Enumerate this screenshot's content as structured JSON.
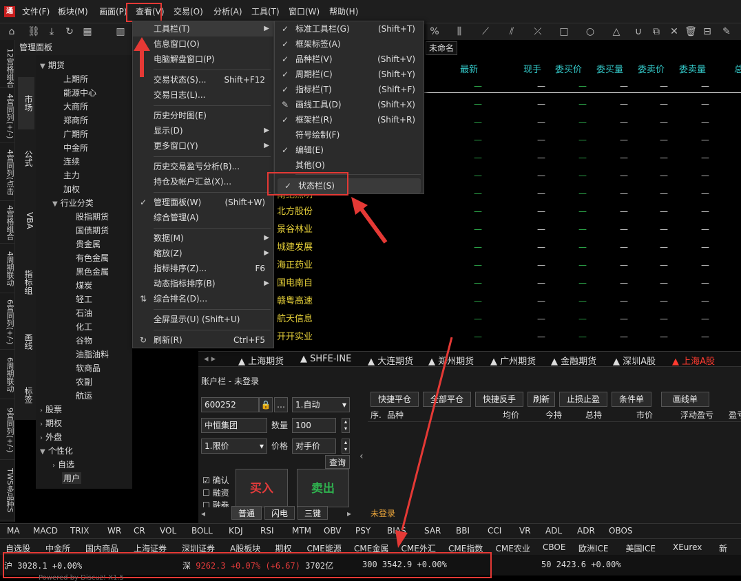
{
  "app": {
    "logo_text": "通"
  },
  "menubar": {
    "items": [
      "文件(F)",
      "板块(M)",
      "画面(P)",
      "查看(V)",
      "交易(O)",
      "分析(A)",
      "工具(T)",
      "窗口(W)",
      "帮助(H)"
    ]
  },
  "left_strip": {
    "tabs": [
      "12宫格组合",
      "4宫同列(+/-)",
      "4宫同列(点击",
      "4宫格组合",
      "4周期联动",
      "6宫同列(+/-)",
      "6周期联动",
      "9宫同列(+/-)",
      "TWS多品种S"
    ]
  },
  "mgmt_panel": {
    "title": "管理面板",
    "categories": [
      "市场",
      "公式",
      "VBA",
      "指标组",
      "画线",
      "标签"
    ],
    "tree": {
      "futures": "期货",
      "futures_children": [
        "上期所",
        "能源中心",
        "大商所",
        "郑商所",
        "广期所",
        "中金所",
        "连续",
        "主力",
        "加权"
      ],
      "industry": "行业分类",
      "industry_children": [
        "股指期货",
        "国债期货",
        "贵金属",
        "有色金属",
        "黑色金属",
        "煤炭",
        "轻工",
        "石油",
        "化工",
        "谷物",
        "油脂油料",
        "软商品",
        "农副",
        "航运"
      ],
      "others": [
        "股票",
        "期权",
        "外盘",
        "个性化"
      ],
      "personal_children": [
        "自选",
        "用户"
      ]
    }
  },
  "main": {
    "tab": "未命名",
    "columns": [
      "最新",
      "现手",
      "委买价",
      "委买量",
      "委卖价",
      "委卖量",
      "总"
    ],
    "placeholder": "—",
    "partial_stock": "南纪照明",
    "stocks": [
      "北方股份",
      "景谷林业",
      "城建发展",
      "海正药业",
      "国电南自",
      "赣粤高速",
      "航天信息",
      "开开实业"
    ]
  },
  "market_tabs": [
    "上海期货",
    "SHFE-INE",
    "大连期货",
    "郑州期货",
    "广州期货",
    "金融期货",
    "深圳A股",
    "上海A股"
  ],
  "account": {
    "title": "账户栏 - 未登录",
    "code": "600252",
    "name": "中恒集团",
    "mode": "1.自动",
    "qty_label": "数量",
    "qty": "100",
    "price_type": "1.限价",
    "price_label": "价格",
    "price": "对手价",
    "query": "查询",
    "buttons": [
      "快捷平仓",
      "全部平仓",
      "快捷反手",
      "刷新",
      "止损止盈",
      "条件单",
      "画线单"
    ],
    "table_headers": [
      "序.",
      "品种",
      "均价",
      "今持",
      "总持",
      "市价",
      "浮动盈亏",
      "盈亏"
    ],
    "checks": [
      "确认",
      "融资",
      "融券"
    ],
    "buy": "买入",
    "sell": "卖出",
    "order_tabs": [
      "普通",
      "闪电",
      "三键"
    ],
    "not_logged": "未登录"
  },
  "indicators": [
    "MA",
    "MACD",
    "TRIX",
    "WR",
    "CR",
    "VOL",
    "BOLL",
    "KDJ",
    "RSI",
    "MTM",
    "OBV",
    "PSY",
    "BIAS",
    "SAR",
    "BBI",
    "CCI",
    "VR",
    "ADL",
    "ADR",
    "OBOS"
  ],
  "category_bar": [
    "自选股",
    "中金所",
    "国内商品",
    "上海证券",
    "深圳证券",
    "A股板块",
    "期权",
    "CME能源",
    "CME金属",
    "CME外汇",
    "CME指数",
    "CME农业",
    "CBOE",
    "欧洲ICE",
    "美国ICE",
    "XEurex",
    "新"
  ],
  "status": {
    "sh_label": "沪",
    "sh_value": "3028.1 +0.00%",
    "sz_label": "深",
    "sz_value": "9262.3 +0.07% (+6.67)",
    "sz_amount": "3702亿",
    "i300_label": "300",
    "i300_value": "3542.9 +0.00%",
    "i50_label": "50",
    "i50_value": "2423.6 +0.00%",
    "powered": "Powered by Discuz! X1.5"
  },
  "view_menu": {
    "items": [
      {
        "label": "工具栏(T)",
        "shortcut": "",
        "submenu": true
      },
      {
        "label": "信息窗口(O)",
        "shortcut": "",
        "submenu": false
      },
      {
        "label": "电脑解盘窗口(P)",
        "shortcut": "",
        "submenu": false
      },
      {
        "label": "交易状态(S)...",
        "shortcut": "Shift+F12",
        "submenu": false
      },
      {
        "label": "交易日志(L)...",
        "shortcut": "",
        "submenu": false
      },
      {
        "label": "历史分时图(E)",
        "shortcut": "",
        "submenu": false
      },
      {
        "label": "显示(D)",
        "shortcut": "",
        "submenu": true
      },
      {
        "label": "更多窗口(Y)",
        "shortcut": "",
        "submenu": true
      },
      {
        "label": "历史交易盈亏分析(B)...",
        "shortcut": "",
        "submenu": false
      },
      {
        "label": "持仓及帐户汇总(X)...",
        "shortcut": "",
        "submenu": false
      },
      {
        "label": "管理面板(W)",
        "shortcut": "(Shift+W)",
        "submenu": false
      },
      {
        "label": "综合管理(A)",
        "shortcut": "",
        "submenu": false
      },
      {
        "label": "数据(M)",
        "shortcut": "",
        "submenu": true
      },
      {
        "label": "缩放(Z)",
        "shortcut": "",
        "submenu": true
      },
      {
        "label": "指标排序(Z)...",
        "shortcut": "F6",
        "submenu": false
      },
      {
        "label": "动态指标排序(B)",
        "shortcut": "",
        "submenu": true
      },
      {
        "label": "综合排名(D)...",
        "shortcut": "",
        "submenu": false
      },
      {
        "label": "全屏显示(U) (Shift+U)",
        "shortcut": "",
        "submenu": false
      },
      {
        "label": "刷新(R)",
        "shortcut": "Ctrl+F5",
        "submenu": false
      }
    ]
  },
  "tool_submenu": {
    "items": [
      {
        "label": "标准工具栏(G)",
        "shortcut": "(Shift+T)"
      },
      {
        "label": "框架标签(A)",
        "shortcut": ""
      },
      {
        "label": "品种栏(V)",
        "shortcut": "(Shift+V)"
      },
      {
        "label": "周期栏(C)",
        "shortcut": "(Shift+Y)"
      },
      {
        "label": "指标栏(T)",
        "shortcut": "(Shift+F)"
      },
      {
        "label": "画线工具(D)",
        "shortcut": "(Shift+X)"
      },
      {
        "label": "框架栏(R)",
        "shortcut": "(Shift+R)"
      },
      {
        "label": "符号绘制(F)",
        "shortcut": ""
      },
      {
        "label": "编辑(E)",
        "shortcut": ""
      },
      {
        "label": "其他(O)",
        "shortcut": ""
      },
      {
        "label": "状态栏(S)",
        "shortcut": ""
      }
    ]
  }
}
